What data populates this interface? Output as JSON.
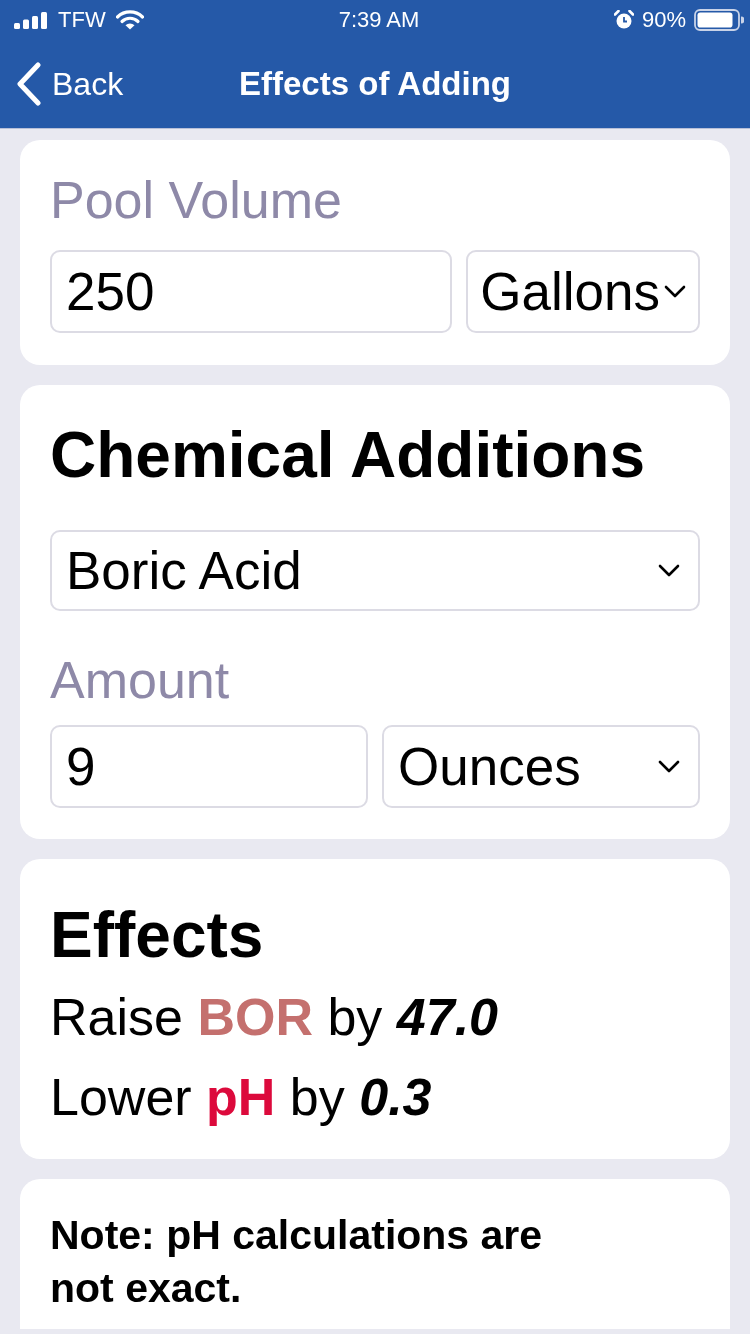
{
  "status_bar": {
    "carrier": "TFW",
    "time": "7:39 AM",
    "battery": "90%"
  },
  "nav": {
    "back": "Back",
    "title": "Effects of Adding"
  },
  "pool_volume": {
    "label": "Pool Volume",
    "value": "250",
    "unit": "Gallons"
  },
  "chemical_additions": {
    "title": "Chemical Additions",
    "chemical": "Boric Acid",
    "amount_label": "Amount",
    "amount": "9",
    "amount_unit": "Ounces"
  },
  "effects": {
    "title": "Effects",
    "items": [
      {
        "action": "Raise",
        "parameter": "BOR",
        "color": "#c4706e",
        "preposition": "by",
        "amount": "47.0"
      },
      {
        "action": "Lower",
        "parameter": "pH",
        "color": "#dc0a3c",
        "preposition": "by",
        "amount": "0.3"
      }
    ]
  },
  "note": "Note: pH calculations are not exact."
}
